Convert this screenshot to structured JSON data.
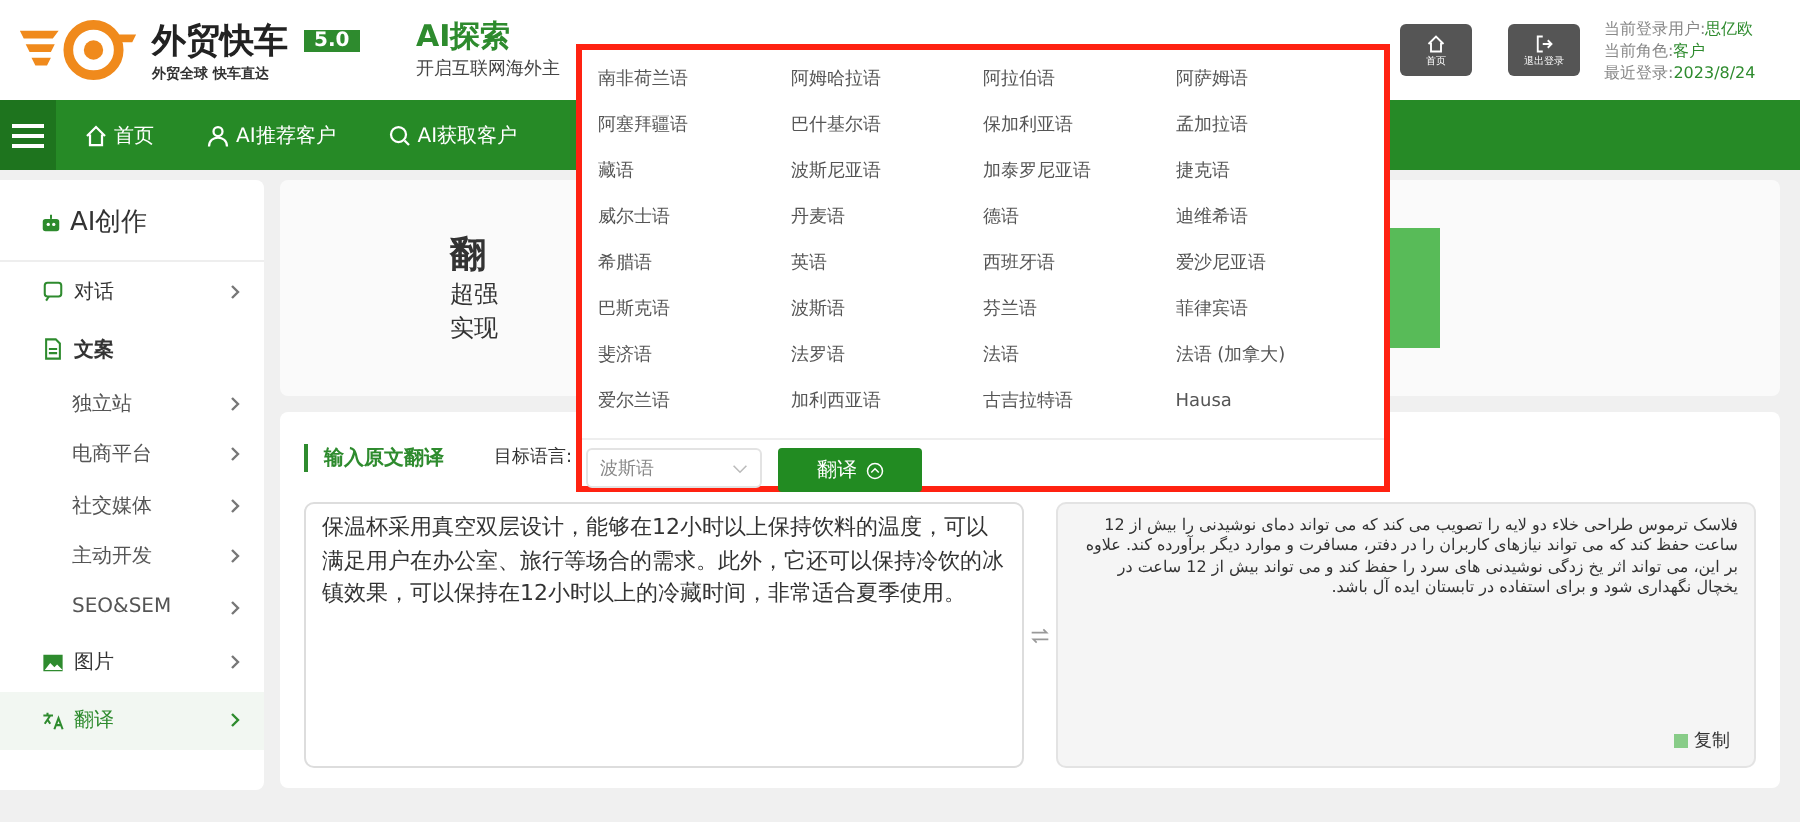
{
  "brand": {
    "name": "外贸快车",
    "version": "5.0",
    "slogan": "外贸全球 快车直达"
  },
  "module": {
    "title": "AI探索",
    "subtitle": "开启互联网海外主"
  },
  "header_buttons": [
    {
      "kind": "home",
      "label": "首页"
    },
    {
      "kind": "logout",
      "label": "退出登录"
    }
  ],
  "user_info": [
    {
      "label": "当前登录用户:",
      "value": "思亿欧"
    },
    {
      "label": "当前角色:",
      "value": "客户"
    },
    {
      "label": "最近登录:",
      "value": "2023/8/24"
    }
  ],
  "nav": [
    {
      "kind": "home",
      "label": "首页"
    },
    {
      "kind": "user",
      "label": "AI推荐客户"
    },
    {
      "kind": "search",
      "label": "AI获取客户"
    }
  ],
  "sidebar": {
    "title": "AI创作",
    "items": [
      {
        "kind": "chat",
        "label": "对话",
        "selected": false
      },
      {
        "kind": "doc",
        "label": "文案",
        "selected": false,
        "children": [
          {
            "label": "独立站",
            "selected": false
          },
          {
            "label": "电商平台",
            "selected": false
          },
          {
            "label": "社交媒体",
            "selected": false
          },
          {
            "label": "主动开发",
            "selected": false
          },
          {
            "label": "SEO&SEM",
            "selected": false
          }
        ]
      },
      {
        "kind": "image",
        "label": "图片",
        "selected": false
      },
      {
        "kind": "translate",
        "label": "翻译",
        "selected": true
      }
    ]
  },
  "banner": {
    "title": "翻",
    "lines": [
      "超强",
      "实现"
    ]
  },
  "translate": {
    "section_title": "输入原文翻译",
    "target_label": "目标语言:",
    "source_text": "保温杯采用真空双层设计，能够在12小时以上保持饮料的温度，可以满足用户在办公室、旅行等场合的需求。此外，它还可以保持冷饮的冰镇效果，可以保持在12小时以上的冷藏时间，非常适合夏季使用。",
    "result_text": "فلاسک ترموس طراحی خلاء دو لایه را تصویب می کند که می تواند دمای نوشیدنی را بیش از 12 ساعت حفظ کند که می تواند نیازهای کاربران را در دفتر، مسافرت و موارد دیگر برآورده کند. علاوه بر این، می تواند اثر یخ زدگی نوشیدنی های سرد را حفظ کند و می تواند بیش از 12 ساعت در یخچال نگهداری شود و برای استفاده در تابستان ایده آل باشد.",
    "copy_label": "复制"
  },
  "language_dropdown": {
    "options": [
      "南非荷兰语",
      "阿姆哈拉语",
      "阿拉伯语",
      "阿萨姆语",
      "阿塞拜疆语",
      "巴什基尔语",
      "保加利亚语",
      "孟加拉语",
      "藏语",
      "波斯尼亚语",
      "加泰罗尼亚语",
      "捷克语",
      "威尔士语",
      "丹麦语",
      "德语",
      "迪维希语",
      "希腊语",
      "英语",
      "西班牙语",
      "爱沙尼亚语",
      "巴斯克语",
      "波斯语",
      "芬兰语",
      "菲律宾语",
      "斐济语",
      "法罗语",
      "法语",
      "法语 (加拿大)",
      "爱尔兰语",
      "加利西亚语",
      "古吉拉特语",
      "Hausa"
    ],
    "selected_value": "波斯语",
    "button_label": "翻译"
  }
}
